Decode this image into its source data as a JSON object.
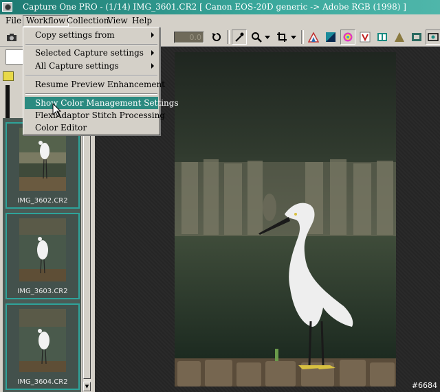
{
  "window": {
    "title": "Capture One PRO  -  (1/14) IMG_3601.CR2  [ Canon EOS-20D generic -> Adobe RGB (1998) ]"
  },
  "menubar": {
    "items": [
      {
        "label": "File"
      },
      {
        "label": "Workflow"
      },
      {
        "label": "Collection"
      },
      {
        "label": "View"
      },
      {
        "label": "Help"
      }
    ],
    "active": "Workflow"
  },
  "toolbar": {
    "rotation_value": "0.0",
    "icons": [
      "camera-icon",
      "rotate-icon",
      "picker-icon",
      "zoom-icon",
      "crop-icon",
      "color-icons"
    ]
  },
  "workflow_menu": {
    "items": [
      {
        "label": "Copy settings from",
        "submenu": true
      },
      {
        "label": "Selected Capture settings",
        "submenu": true
      },
      {
        "label": "All Capture settings",
        "submenu": true
      },
      {
        "label": "Resume Preview Enhancement",
        "submenu": false
      },
      {
        "label": "Show Color Management Settings",
        "submenu": false,
        "highlighted": true
      },
      {
        "label": "FlexiAdaptor Stitch Processing",
        "submenu": false
      },
      {
        "label": "Color Editor",
        "submenu": false
      }
    ]
  },
  "thumbnails": [
    {
      "label": "IMG_3602.CR2"
    },
    {
      "label": "IMG_3603.CR2"
    },
    {
      "label": "IMG_3604.CR2"
    }
  ],
  "viewer": {
    "badge": "#6684"
  },
  "colors": {
    "titlebar": "#2b8a80",
    "menu_highlight": "#2b8a80",
    "thumb_border": "#2ea39a"
  }
}
